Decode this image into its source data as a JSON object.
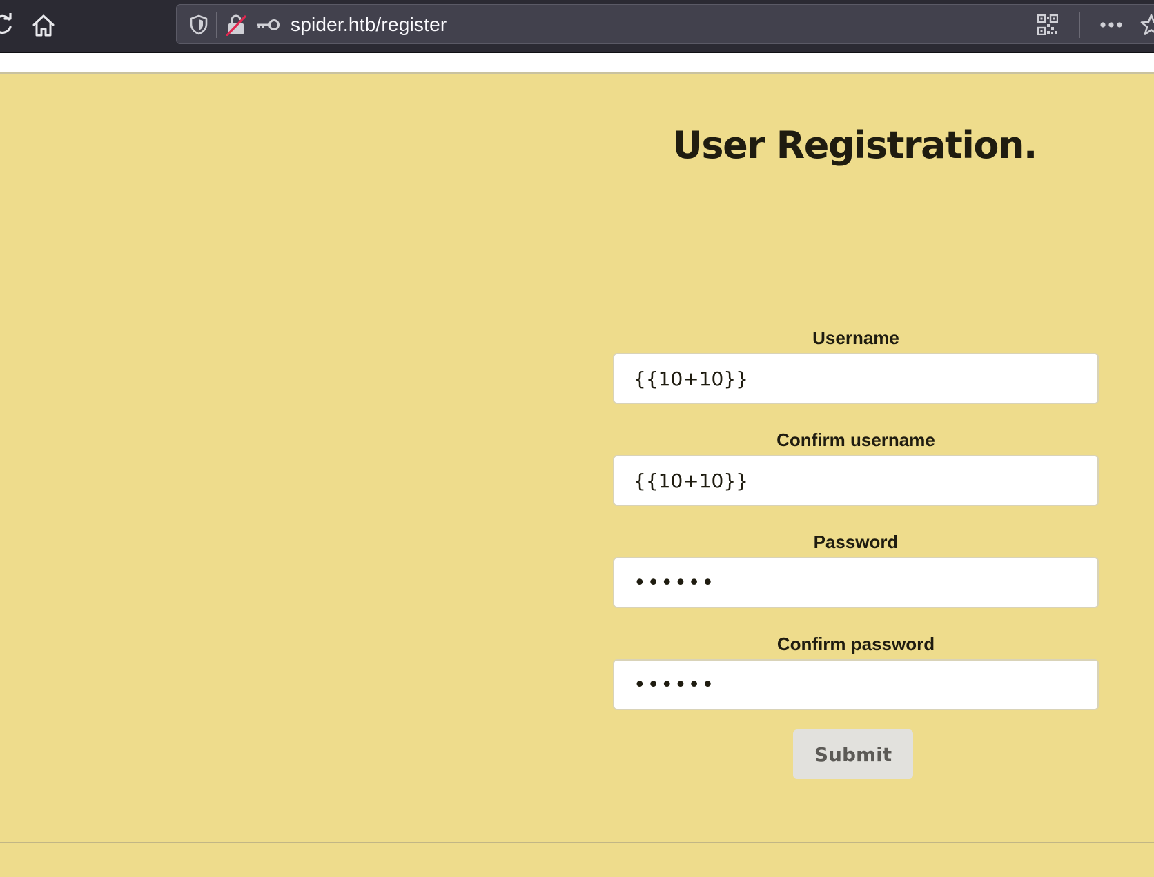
{
  "browser": {
    "url": "spider.htb/register"
  },
  "page": {
    "title": "User Registration.",
    "background_color": "#EEDC8C"
  },
  "form": {
    "fields": [
      {
        "label": "Username",
        "value": "{{10+10}}",
        "type": "text"
      },
      {
        "label": "Confirm username",
        "value": "{{10+10}}",
        "type": "text"
      },
      {
        "label": "Password",
        "value": "••••••",
        "type": "password"
      },
      {
        "label": "Confirm password",
        "value": "••••••",
        "type": "password"
      }
    ],
    "submit_label": "Submit"
  },
  "icons": {
    "reload": "reload-icon",
    "home": "home-icon",
    "shield": "tracking-protection-shield-icon",
    "lock": "insecure-lock-icon",
    "key": "key-icon",
    "qr": "qr-code-icon",
    "more": "more-actions-icon",
    "star": "bookmark-star-icon"
  }
}
